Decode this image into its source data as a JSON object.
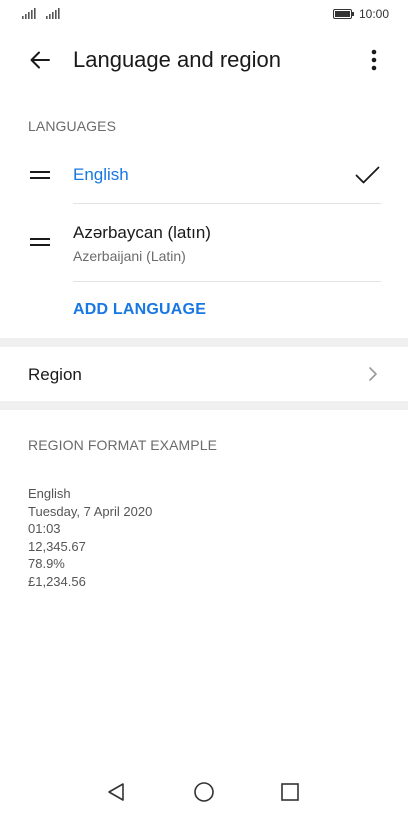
{
  "status_bar": {
    "time": "10:00"
  },
  "header": {
    "title": "Language and region"
  },
  "languages": {
    "section_label": "LANGUAGES",
    "items": [
      {
        "name": "English",
        "subtitle": "",
        "selected": true
      },
      {
        "name": "Azərbaycan (latın)",
        "subtitle": "Azerbaijani (Latin)",
        "selected": false
      }
    ],
    "add_label": "ADD LANGUAGE"
  },
  "region": {
    "label": "Region"
  },
  "format_example": {
    "section_label": "REGION FORMAT EXAMPLE",
    "lines": [
      "English",
      "Tuesday, 7 April 2020",
      "01:03",
      "12,345.67",
      "78.9%",
      "£1,234.56"
    ]
  },
  "colors": {
    "accent": "#1777e3",
    "divider": "#e3e3e3",
    "gap": "#f0f0f0",
    "secondary_text": "#6b6b6b"
  },
  "icons": [
    "signal-icon",
    "battery-icon",
    "back-arrow-icon",
    "more-vert-icon",
    "drag-handle-icon",
    "check-icon",
    "chevron-right-icon",
    "nav-back-icon",
    "nav-home-icon",
    "nav-recents-icon"
  ]
}
